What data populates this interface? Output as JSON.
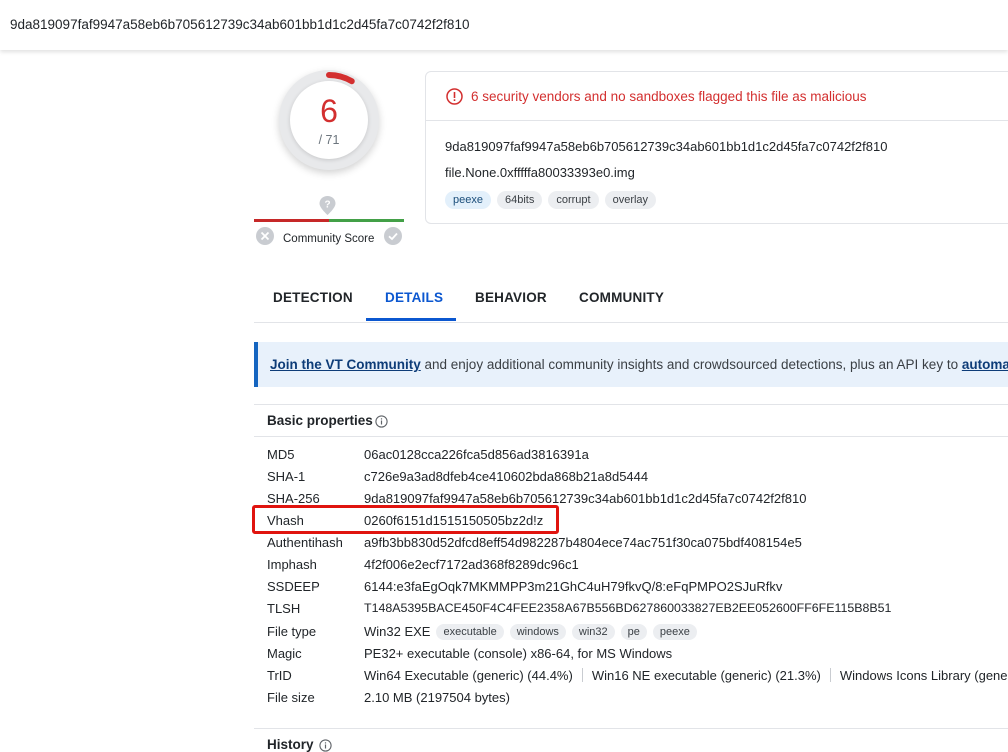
{
  "header": {
    "hash": "9da819097faf9947a58eb6b705612739c34ab601bb1d1c2d45fa7c0742f2f810"
  },
  "score": {
    "detections": "6",
    "total": "/ 71",
    "ratio": 0.0845,
    "ring_color": "#d32f2f"
  },
  "community": {
    "label": "Community Score"
  },
  "alert": {
    "text": "6 security vendors and no sandboxes flagged this file as malicious",
    "hash": "9da819097faf9947a58eb6b705612739c34ab601bb1d1c2d45fa7c0742f2f810",
    "filename": "file.None.0xfffffa80033393e0.img",
    "tags": [
      "peexe",
      "64bits",
      "corrupt",
      "overlay"
    ]
  },
  "tabs": [
    "DETECTION",
    "DETAILS",
    "BEHAVIOR",
    "COMMUNITY"
  ],
  "active_tab": "DETAILS",
  "banner": {
    "link1": "Join the VT Community",
    "middle": " and enjoy additional community insights and crowdsourced detections, plus an API key to ",
    "link2": "automate c"
  },
  "basic": {
    "title": "Basic properties",
    "md5_label": "MD5",
    "md5": "06ac0128cca226fca5d856ad3816391a",
    "sha1_label": "SHA-1",
    "sha1": "c726e9a3ad8dfeb4ce410602bda868b21a8d5444",
    "sha256_label": "SHA-256",
    "sha256": "9da819097faf9947a58eb6b705612739c34ab601bb1d1c2d45fa7c0742f2f810",
    "vhash_label": "Vhash",
    "vhash": "0260f6151d1515150505bz2d!z",
    "authentihash_label": "Authentihash",
    "authentihash": "a9fb3bb830d52dfcd8eff54d982287b4804ece74ac751f30ca075bdf408154e5",
    "imphash_label": "Imphash",
    "imphash": "4f2f006e2ecf7172ad368f8289dc96c1",
    "ssdeep_label": "SSDEEP",
    "ssdeep": "6144:e3faEgOqk7MKMMPP3m21GhC4uH79fkvQ/8:eFqPMPO2SJuRfkv",
    "tlsh_label": "TLSH",
    "tlsh": "T148A5395BACE450F4C4FEE2358A67B556BD627860033827EB2EE052600FF6FE115B8B51",
    "filetype_label": "File type",
    "filetype": "Win32 EXE",
    "filetype_tags": [
      "executable",
      "windows",
      "win32",
      "pe",
      "peexe"
    ],
    "magic_label": "Magic",
    "magic": "PE32+ executable (console) x86-64, for MS Windows",
    "trid_label": "TrID",
    "trid": [
      "Win64 Executable (generic) (44.4%)",
      "Win16 NE executable (generic) (21.3%)",
      "Windows Icons Library (generi"
    ],
    "filesize_label": "File size",
    "filesize": "2.10 MB (2197504 bytes)"
  },
  "history": {
    "title": "History"
  },
  "colors": {
    "danger": "#d32f2f",
    "accent": "#0b57d0",
    "highlight": "#e0140f"
  }
}
